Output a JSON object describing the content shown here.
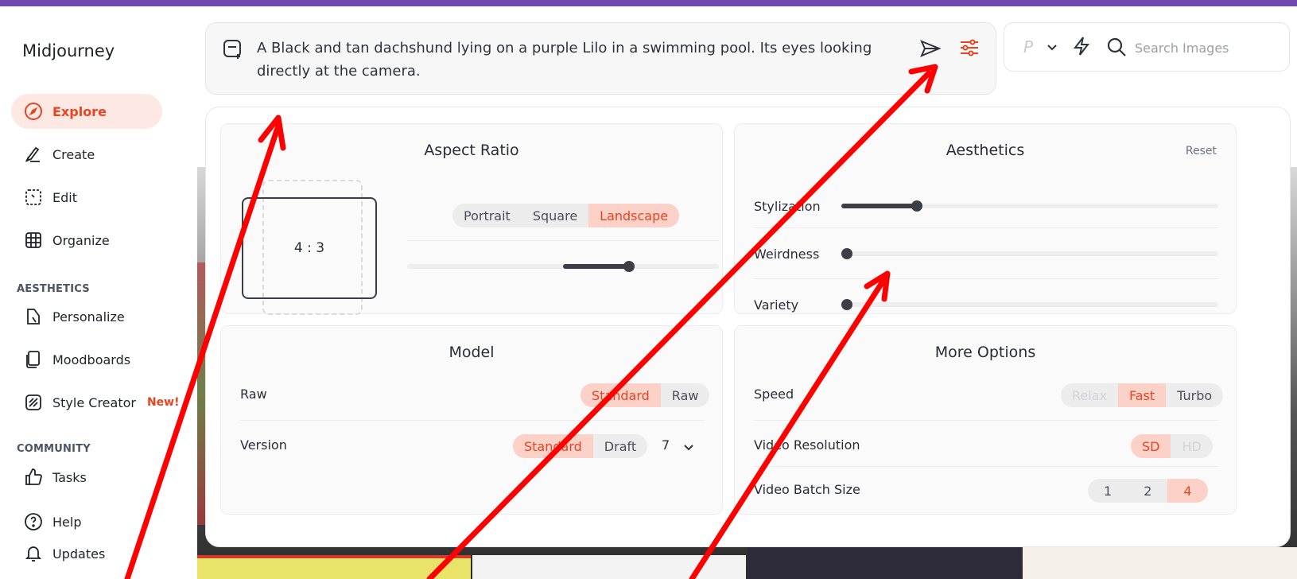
{
  "app": {
    "brand": "Midjourney",
    "accent": "#e54522",
    "top_bar_color": "#6f48b0"
  },
  "sidebar": {
    "items": [
      {
        "label": "Explore",
        "icon": "compass-icon",
        "active": true
      },
      {
        "label": "Create",
        "icon": "brush-icon"
      },
      {
        "label": "Edit",
        "icon": "edit-icon"
      },
      {
        "label": "Organize",
        "icon": "grid-icon"
      }
    ],
    "aesthetics_header": "AESTHETICS",
    "aesthetics_items": [
      {
        "label": "Personalize",
        "icon": "personalize-icon"
      },
      {
        "label": "Moodboards",
        "icon": "moodboards-icon"
      },
      {
        "label": "Style Creator",
        "icon": "style-creator-icon",
        "badge": "New!"
      }
    ],
    "community_header": "COMMUNITY",
    "community_items": [
      {
        "label": "Tasks",
        "icon": "thumbs-up-icon"
      },
      {
        "label": "Help",
        "icon": "help-icon"
      },
      {
        "label": "Updates",
        "icon": "bell-icon"
      }
    ]
  },
  "prompt": {
    "text": "A Black and tan dachshund lying on a purple Lilo in a swimming pool. Its eyes looking directly at the camera."
  },
  "search": {
    "p_label": "P",
    "placeholder": "Search Images"
  },
  "aspect_ratio": {
    "title": "Aspect Ratio",
    "ratio": "4 : 3",
    "options": [
      "Portrait",
      "Square",
      "Landscape"
    ],
    "selected": "Landscape"
  },
  "aesthetics": {
    "title": "Aesthetics",
    "reset": "Reset",
    "sliders": [
      {
        "label": "Stylization",
        "value": 0.2
      },
      {
        "label": "Weirdness",
        "value": 0.0
      },
      {
        "label": "Variety",
        "value": 0.0
      }
    ]
  },
  "model": {
    "title": "Model",
    "raw_label": "Raw",
    "raw_options": [
      "Standard",
      "Raw"
    ],
    "raw_selected": "Standard",
    "version_label": "Version",
    "version_options": [
      "Standard",
      "Draft"
    ],
    "version_selected": "Standard",
    "version_number": "7"
  },
  "more_options": {
    "title": "More Options",
    "speed_label": "Speed",
    "speed_options": [
      "Relax",
      "Fast",
      "Turbo"
    ],
    "speed_selected": "Fast",
    "video_res_label": "Video Resolution",
    "video_res_options": [
      "SD",
      "HD"
    ],
    "video_res_selected": "SD",
    "batch_label": "Video Batch Size",
    "batch_options": [
      "1",
      "2",
      "4"
    ],
    "batch_selected": "4"
  }
}
